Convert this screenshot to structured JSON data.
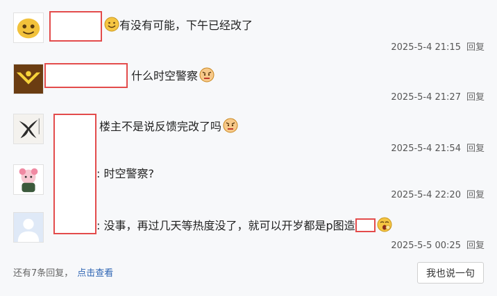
{
  "replies": [
    {
      "text": "有没有可能，下午已经改了",
      "time": "2025-5-4 21:15",
      "reply_label": "回复",
      "emoji": "smile-emoji"
    },
    {
      "text": "什么时空警察",
      "time": "2025-5-4 21:27",
      "reply_label": "回复",
      "emoji": "angry-emoji"
    },
    {
      "text": "楼主不是说反馈完改了吗",
      "time": "2025-5-4 21:54",
      "reply_label": "回复",
      "emoji": "angry-emoji"
    },
    {
      "text": ": 时空警察?",
      "time": "2025-5-4 22:20",
      "reply_label": "回复",
      "emoji": ""
    },
    {
      "text": ": 没事，再过几天等热度没了，就可以开岁都是p图造",
      "time": "2025-5-5 00:25",
      "reply_label": "回复",
      "emoji": "yawn-emoji"
    }
  ],
  "footer": {
    "more_text": "还有7条回复，",
    "view_link": "点击查看",
    "say_button": "我也说一句"
  },
  "colors": {
    "redact_border": "#e34b4b",
    "link": "#2d64b3",
    "background": "#f7f8fa"
  }
}
